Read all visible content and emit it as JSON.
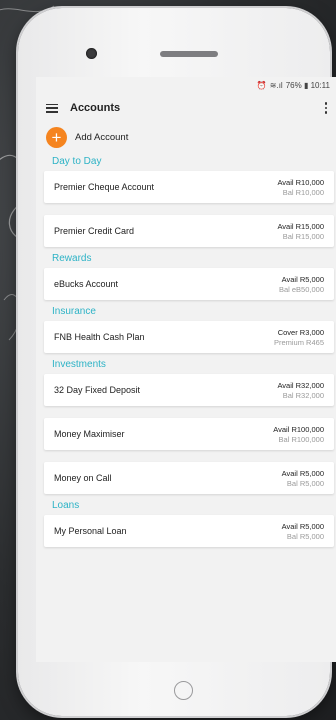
{
  "status_bar": {
    "text": "76% ▮ 10:11"
  },
  "app_bar": {
    "title": "Accounts"
  },
  "add_account": {
    "label": "Add Account"
  },
  "sections": [
    {
      "title": "Day to Day",
      "accounts": [
        {
          "name": "Premier Cheque Account",
          "primary": "Avail R10,000",
          "secondary": "Bal R10,000"
        },
        {
          "name": "Premier Credit Card",
          "primary": "Avail R15,000",
          "secondary": "Bal R15,000"
        }
      ]
    },
    {
      "title": "Rewards",
      "accounts": [
        {
          "name": "eBucks Account",
          "primary": "Avail R5,000",
          "secondary": "Bal eB50,000"
        }
      ]
    },
    {
      "title": "Insurance",
      "accounts": [
        {
          "name": "FNB Health Cash Plan",
          "primary": "Cover R3,000",
          "secondary": "Premium R465"
        }
      ]
    },
    {
      "title": "Investments",
      "accounts": [
        {
          "name": "32 Day Fixed Deposit",
          "primary": "Avail R32,000",
          "secondary": "Bal R32,000"
        },
        {
          "name": "Money Maximiser",
          "primary": "Avail R100,000",
          "secondary": "Bal R100,000"
        },
        {
          "name": "Money on Call",
          "primary": "Avail R5,000",
          "secondary": "Bal R5,000"
        }
      ]
    },
    {
      "title": "Loans",
      "accounts": [
        {
          "name": "My Personal Loan",
          "primary": "Avail R5,000",
          "secondary": "Bal R5,000"
        }
      ]
    }
  ],
  "colors": {
    "accent": "#2db3c6",
    "add_button": "#f5841f",
    "background": "#f2f2f2"
  }
}
